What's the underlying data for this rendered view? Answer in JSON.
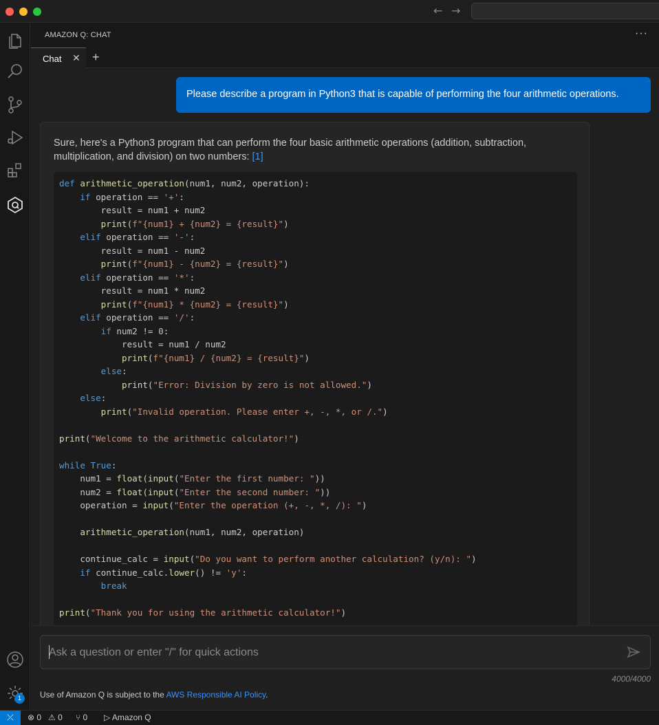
{
  "panel": {
    "title": "AMAZON Q: CHAT",
    "more": "···"
  },
  "tabs": [
    {
      "label": "Chat",
      "close": "✕"
    }
  ],
  "tab_add": "+",
  "nav": {
    "back": "←",
    "forward": "→"
  },
  "chat": {
    "user_message": "Please describe a program in Python3 that is capable of performing the four arithmetic operations.",
    "answer_intro": "Sure, here's a Python3 program that can perform the four basic arithmetic operations (addition, subtraction, multiplication, and division) on two numbers:",
    "citation": "[1]",
    "code_lines": [
      "def arithmetic_operation(num1, num2, operation):",
      "    if operation == '+':",
      "        result = num1 + num2",
      "        print(f\"{num1} + {num2} = {result}\")",
      "    elif operation == '-':",
      "        result = num1 - num2",
      "        print(f\"{num1} - {num2} = {result}\")",
      "    elif operation == '*':",
      "        result = num1 * num2",
      "        print(f\"{num1} * {num2} = {result}\")",
      "    elif operation == '/':",
      "        if num2 != 0:",
      "            result = num1 / num2",
      "            print(f\"{num1} / {num2} = {result}\")",
      "        else:",
      "            print(\"Error: Division by zero is not allowed.\")",
      "    else:",
      "        print(\"Invalid operation. Please enter +, -, *, or /.\")",
      "",
      "print(\"Welcome to the arithmetic calculator!\")",
      "",
      "while True:",
      "    num1 = float(input(\"Enter the first number: \"))",
      "    num2 = float(input(\"Enter the second number: \"))",
      "    operation = input(\"Enter the operation (+, -, *, /): \")",
      "",
      "    arithmetic_operation(num1, num2, operation)",
      "",
      "    continue_calc = input(\"Do you want to perform another calculation? (y/n): \")",
      "    if continue_calc.lower() != 'y':",
      "        break",
      "",
      "print(\"Thank you for using the arithmetic calculator!\")"
    ]
  },
  "input": {
    "placeholder": "Ask a question or enter \"/\" for quick actions",
    "value": "",
    "counter": "4000/4000"
  },
  "policy": {
    "prefix": "Use of Amazon Q is subject to the ",
    "link": "AWS Responsible AI Policy",
    "suffix": "."
  },
  "statusbar": {
    "remote": "⤫",
    "errors": "⊗ 0",
    "warnings": "⚠ 0",
    "ports": "⑂ 0",
    "amazon_q": "▷ Amazon Q"
  },
  "settings_badge": "1",
  "colors": {
    "accent": "#0078d4",
    "user_bubble": "#0066c4",
    "link": "#3794ff"
  },
  "icons": [
    "explorer-icon",
    "search-icon",
    "source-control-icon",
    "run-debug-icon",
    "extensions-icon",
    "amazon-q-icon",
    "account-icon",
    "settings-icon",
    "send-icon"
  ]
}
